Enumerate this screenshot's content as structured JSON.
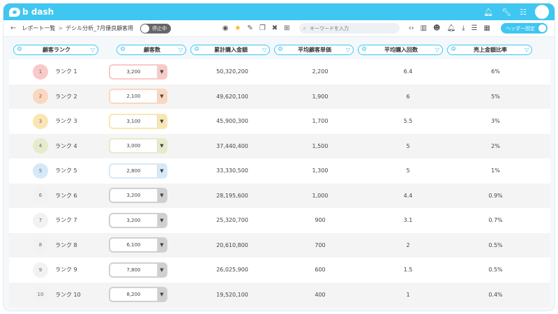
{
  "app": {
    "logo_text": "b dash"
  },
  "topbar": {
    "icons": [
      "bell-icon",
      "wrench-icon",
      "grid-icon",
      "avatar"
    ]
  },
  "toolbar": {
    "back_icon": "←",
    "breadcrumb": [
      "レポート一覧",
      "デシル分析_7月優良顧客用"
    ],
    "breadcrumb_sep": ">",
    "toggle_label": "停止中",
    "search_placeholder": "キーワードを入力",
    "header_setting_label": "ヘッダー固定"
  },
  "columns": [
    {
      "label": "顧客ランク"
    },
    {
      "label": "顧客数"
    },
    {
      "label": "累計購入金額"
    },
    {
      "label": "平均顧客単価"
    },
    {
      "label": "平均購入回数"
    },
    {
      "label": "売上金額比率"
    }
  ],
  "rows": [
    {
      "rank_no": "1",
      "rank": "ランク 1",
      "count": "3,200",
      "total": "50,320,200",
      "avg_price": "2,200",
      "avg_count": "6.4",
      "ratio": "6%",
      "color": "#f9c9c7"
    },
    {
      "rank_no": "2",
      "rank": "ランク 2",
      "count": "2,100",
      "total": "49,620,100",
      "avg_price": "1,900",
      "avg_count": "6",
      "ratio": "5%",
      "color": "#fbd7bd"
    },
    {
      "rank_no": "3",
      "rank": "ランク 3",
      "count": "3,100",
      "total": "45,900,300",
      "avg_price": "1,700",
      "avg_count": "5.5",
      "ratio": "3%",
      "color": "#f9e6b3"
    },
    {
      "rank_no": "4",
      "rank": "ランク 4",
      "count": "3,000",
      "total": "37,440,400",
      "avg_price": "1,500",
      "avg_count": "5",
      "ratio": "2%",
      "color": "#e6ebcb"
    },
    {
      "rank_no": "5",
      "rank": "ランク 5",
      "count": "2,800",
      "total": "33,330,500",
      "avg_price": "1,300",
      "avg_count": "5",
      "ratio": "1%",
      "color": "#d6e9f8"
    },
    {
      "rank_no": "6",
      "rank": "ランク 6",
      "count": "3,200",
      "total": "28,195,600",
      "avg_price": "1,000",
      "avg_count": "4.4",
      "ratio": "0.9%",
      "color": "#d0d0d0"
    },
    {
      "rank_no": "7",
      "rank": "ランク 7",
      "count": "3,200",
      "total": "25,320,700",
      "avg_price": "900",
      "avg_count": "3.1",
      "ratio": "0.7%",
      "color": "#d0d0d0"
    },
    {
      "rank_no": "8",
      "rank": "ランク 8",
      "count": "6,100",
      "total": "20,610,800",
      "avg_price": "700",
      "avg_count": "2",
      "ratio": "0.5%",
      "color": "#d0d0d0"
    },
    {
      "rank_no": "9",
      "rank": "ランク 9",
      "count": "7,800",
      "total": "26,025,900",
      "avg_price": "600",
      "avg_count": "1.5",
      "ratio": "0.5%",
      "color": "#d0d0d0"
    },
    {
      "rank_no": "10",
      "rank": "ランク 10",
      "count": "8,200",
      "total": "19,520,100",
      "avg_price": "400",
      "avg_count": "1",
      "ratio": "0.4%",
      "color": "#d0d0d0"
    }
  ]
}
